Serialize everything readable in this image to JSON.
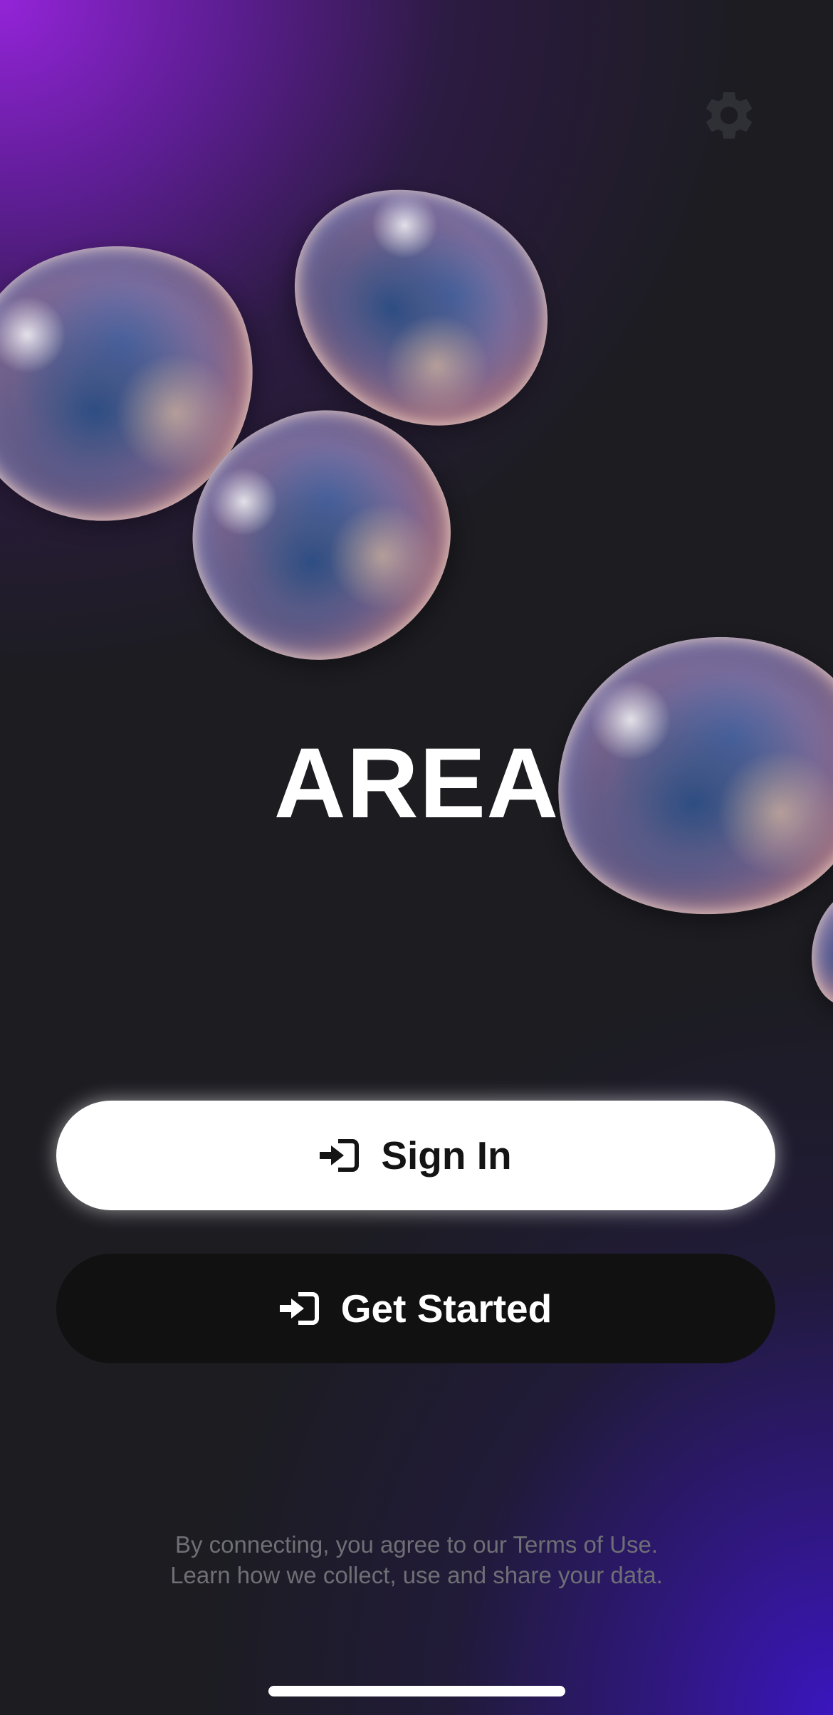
{
  "app": {
    "title": "AREA"
  },
  "header": {
    "settings_icon": "gear-icon"
  },
  "actions": {
    "sign_in_label": "Sign In",
    "sign_in_icon": "sign-in-icon",
    "get_started_label": "Get Started",
    "get_started_icon": "sign-in-icon"
  },
  "legal": {
    "line1": "By connecting, you agree to our Terms of Use.",
    "line2": "Learn how we collect, use and share your data."
  },
  "colors": {
    "background": "#1c1c21",
    "accent_purple": "#9624dc",
    "accent_indigo": "#3a16be",
    "primary_button": "#ffffff",
    "secondary_button": "#111111",
    "legal_text": "#6f6f75",
    "settings_icon": "#2f3036"
  }
}
